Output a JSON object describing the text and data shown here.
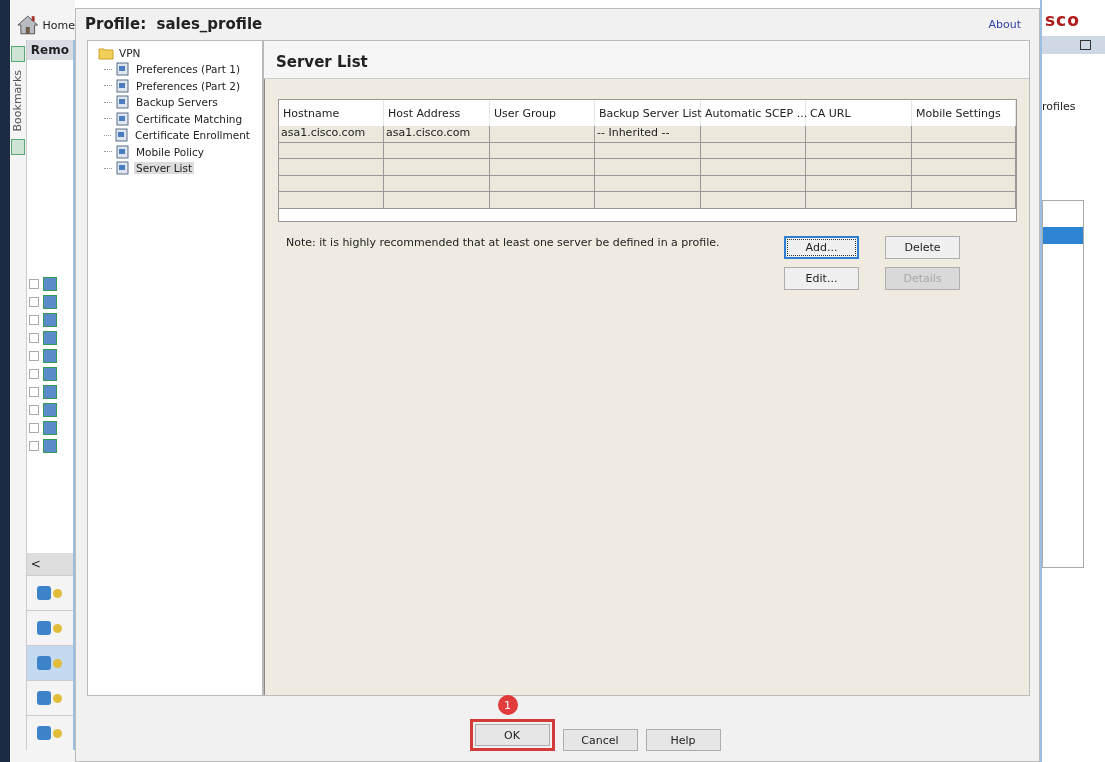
{
  "background_app": {
    "home_label": "Home",
    "panel_title": "Remo",
    "bookmarks_label": "Bookmarks",
    "logo": "sco",
    "side_text": "rofiles",
    "back_arrow": "<"
  },
  "dialog": {
    "title": "Profile:  sales_profile",
    "about_link": "About",
    "tree": {
      "label": "VPN",
      "children": [
        {
          "label": "Preferences (Part 1)",
          "selected": false
        },
        {
          "label": "Preferences (Part 2)",
          "selected": false
        },
        {
          "label": "Backup Servers",
          "selected": false
        },
        {
          "label": "Certificate Matching",
          "selected": false
        },
        {
          "label": "Certificate Enrollment",
          "selected": false
        },
        {
          "label": "Mobile Policy",
          "selected": false
        },
        {
          "label": "Server List",
          "selected": true
        }
      ]
    },
    "panel_title": "Server List",
    "table": {
      "columns": [
        "Hostname",
        "Host Address",
        "User Group",
        "Backup Server List",
        "Automatic SCEP ...",
        "CA URL",
        "Mobile Settings"
      ],
      "rows": [
        [
          "asa1.cisco.com",
          "asa1.cisco.com",
          null,
          "-- Inherited --",
          null,
          null,
          null
        ],
        [
          null,
          null,
          null,
          null,
          null,
          null,
          null
        ],
        [
          null,
          null,
          null,
          null,
          null,
          null,
          null
        ],
        [
          null,
          null,
          null,
          null,
          null,
          null,
          null
        ],
        [
          null,
          null,
          null,
          null,
          null,
          null,
          null
        ]
      ]
    },
    "note": "Note: it is highly recommended that at least one server be defined in a profile.",
    "actions": [
      {
        "label": "Add...",
        "focused": true,
        "disabled": false
      },
      {
        "label": "Delete",
        "focused": false,
        "disabled": false
      },
      {
        "label": "Edit...",
        "focused": false,
        "disabled": false
      },
      {
        "label": "Details",
        "focused": false,
        "disabled": true
      }
    ],
    "footer_buttons": [
      {
        "label": "OK",
        "highlighted": true
      },
      {
        "label": "Cancel",
        "highlighted": false
      },
      {
        "label": "Help",
        "highlighted": false
      }
    ],
    "callout": {
      "number": "1"
    }
  }
}
